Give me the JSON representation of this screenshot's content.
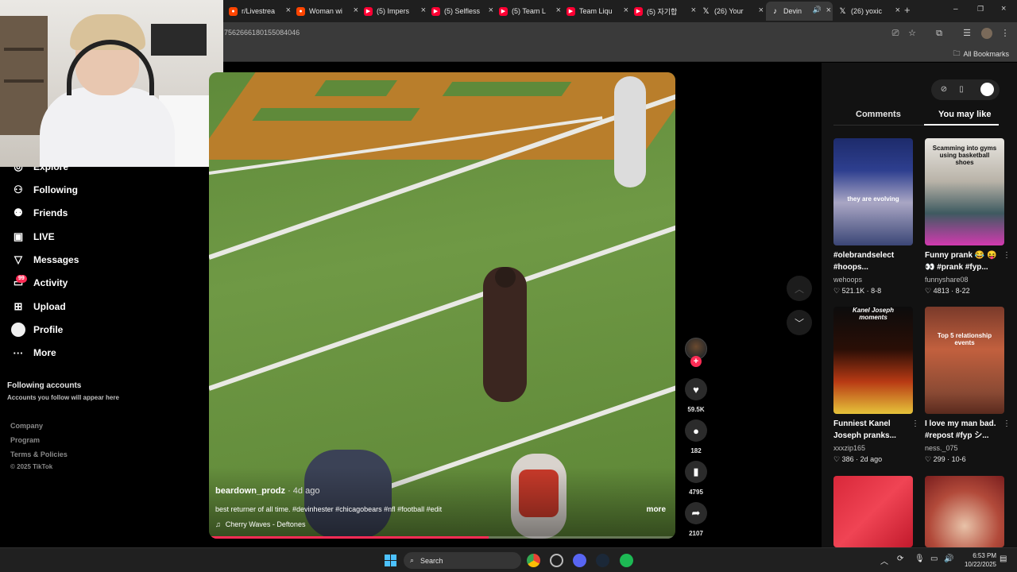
{
  "browser": {
    "tabs": [
      {
        "label": "r/Livestrea",
        "icon": "reddit-icon",
        "color": "#ff4500"
      },
      {
        "label": "Woman wi",
        "icon": "reddit-icon",
        "color": "#ff4500"
      },
      {
        "label": "(5) Impers",
        "icon": "youtube-icon",
        "color": "#ff0033"
      },
      {
        "label": "(5) Selfless",
        "icon": "youtube-icon",
        "color": "#ff0033"
      },
      {
        "label": "(5) Team L",
        "icon": "youtube-icon",
        "color": "#ff0033"
      },
      {
        "label": "Team Liqu",
        "icon": "youtube-icon",
        "color": "#ff0033"
      },
      {
        "label": "(5) 자기합",
        "icon": "youtube-icon",
        "color": "#ff0033"
      },
      {
        "label": "(26) Your",
        "icon": "x-icon",
        "color": "#000000"
      },
      {
        "label": "Devin",
        "icon": "tiktok-icon",
        "color": "#000000"
      },
      {
        "label": "(26) yoxic",
        "icon": "x-icon",
        "color": "#000000"
      }
    ],
    "url": "7562666180155084046",
    "all_bookmarks": "All Bookmarks"
  },
  "sidebar": {
    "items": [
      {
        "label": "Explore",
        "icon": "compass-icon"
      },
      {
        "label": "Following",
        "icon": "following-icon"
      },
      {
        "label": "Friends",
        "icon": "friends-icon"
      },
      {
        "label": "LIVE",
        "icon": "live-icon"
      },
      {
        "label": "Messages",
        "icon": "messages-icon"
      },
      {
        "label": "Activity",
        "icon": "activity-icon"
      },
      {
        "label": "Upload",
        "icon": "upload-icon"
      },
      {
        "label": "Profile",
        "icon": "profile-icon"
      },
      {
        "label": "More",
        "icon": "more-icon"
      }
    ],
    "activity_badge": "99",
    "following_accounts_title": "Following accounts",
    "following_accounts_desc": "Accounts you follow will appear here",
    "footer": [
      "Company",
      "Program",
      "Terms & Policies",
      "© 2025 TikTok"
    ]
  },
  "video": {
    "author": "beardown_prodz",
    "age": " · 4d ago",
    "caption": "best returner of all time. #devinhester #chicagobears #nfl #football #edit",
    "music": "Cherry Waves - Deftones",
    "more": "more",
    "progress": 0.6,
    "accent": "#fe2c55"
  },
  "actions": {
    "likes": "59.5K",
    "comments": "182",
    "saves": "4795",
    "shares": "2107"
  },
  "panel": {
    "tab_comments": "Comments",
    "tab_you_may_like": "You may like",
    "cards": [
      {
        "title1": "#olebrandselect",
        "title2": "#hoops...",
        "author": "wehoops",
        "stats": "♡ 521.1K · 8-8",
        "thumb_text": "they are evolving"
      },
      {
        "title1": "Funny prank 😂 😝",
        "title2": "👀 #prank #fyp...",
        "author": "funnyshare08",
        "stats": "♡ 4813 · 8-22",
        "thumb_text": "Scamming into gyms using basketball shoes"
      },
      {
        "title1": "Funniest Kanel",
        "title2": "Joseph pranks...",
        "author": "xxxzip165",
        "stats": "♡ 386 · 2d ago",
        "thumb_text": "Kanel Joseph moments"
      },
      {
        "title1": "I love my man bad.",
        "title2": "#repost #fyp シ...",
        "author": "ness._075",
        "stats": "♡ 299 · 10-6",
        "thumb_text": "Top 5 relationship events"
      }
    ]
  },
  "taskbar": {
    "search": "Search",
    "time": "6:53 PM",
    "date": "10/22/2025"
  }
}
